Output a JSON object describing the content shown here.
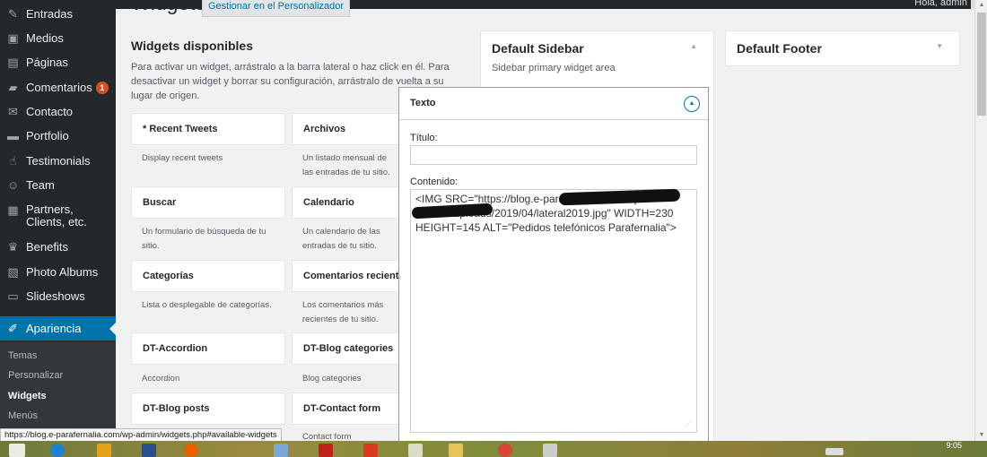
{
  "admin_bar": {
    "howdy": "Hola, admin"
  },
  "sidebar": {
    "items": [
      {
        "label": "Entradas",
        "icon": "pin-icon",
        "glyph": "✎"
      },
      {
        "label": "Medios",
        "icon": "media-icon",
        "glyph": "▣"
      },
      {
        "label": "Páginas",
        "icon": "pages-icon",
        "glyph": "▤"
      },
      {
        "label": "Comentarios",
        "icon": "comments-icon",
        "glyph": "▰",
        "badge": "1"
      },
      {
        "label": "Contacto",
        "icon": "mail-icon",
        "glyph": "✉"
      },
      {
        "label": "Portfolio",
        "icon": "briefcase-icon",
        "glyph": "▬"
      },
      {
        "label": "Testimonials",
        "icon": "thumbs-up-icon",
        "glyph": "☝"
      },
      {
        "label": "Team",
        "icon": "team-icon",
        "glyph": "☺"
      },
      {
        "label": "Partners, Clients, etc.",
        "icon": "grid-icon",
        "glyph": "▦"
      },
      {
        "label": "Benefits",
        "icon": "trophy-icon",
        "glyph": "♛"
      },
      {
        "label": "Photo Albums",
        "icon": "album-icon",
        "glyph": "▧"
      },
      {
        "label": "Slideshows",
        "icon": "slides-icon",
        "glyph": "▭"
      },
      {
        "label": "Apariencia",
        "icon": "paintbrush-icon",
        "glyph": "✐"
      }
    ],
    "submenu": [
      "Temas",
      "Personalizar",
      "Widgets",
      "Menús"
    ]
  },
  "page": {
    "title": "Widgets",
    "manage_link": "Gestionar en el Personalizador"
  },
  "available": {
    "heading": "Widgets disponibles",
    "description": "Para activar un widget, arrástralo a la barra lateral o haz click en él. Para desactivar un widget y borrar su configuración, arrástralo de vuelta a su lugar de origen.",
    "widgets": [
      {
        "name": "* Recent Tweets",
        "desc": "Display recent tweets"
      },
      {
        "name": "Archivos",
        "desc": "Un listado mensual de las entradas de tu sitio."
      },
      {
        "name": "Buscar",
        "desc": "Un formulario de búsqueda de tu sitio."
      },
      {
        "name": "Calendario",
        "desc": "Un calendario de las entradas de tu sitio."
      },
      {
        "name": "Categorías",
        "desc": "Lista o desplegable de categorías."
      },
      {
        "name": "Comentarios recientes",
        "desc": "Los comentarios más recientes de tu sitio."
      },
      {
        "name": "DT-Accordion",
        "desc": "Accordion"
      },
      {
        "name": "DT-Blog categories",
        "desc": "Blog categories"
      },
      {
        "name": "DT-Blog posts",
        "desc": ""
      },
      {
        "name": "DT-Contact form",
        "desc": "Contact form"
      }
    ]
  },
  "sidebars": {
    "default_sidebar": {
      "title": "Default Sidebar",
      "desc": "Sidebar primary widget area"
    },
    "default_footer": {
      "title": "Default Footer"
    }
  },
  "texto_widget": {
    "title": "Texto",
    "title_label": "Título:",
    "title_value": "",
    "content_label": "Contenido:",
    "content_value": "<IMG SRC=\"https://blog.e-parafernalia.com/wp-content/uploads/2019/04/lateral2019.jpg\" WIDTH=230 HEIGHT=145 ALT=\"Pedidos telefónicos Parafernalia\">"
  },
  "status_url": "https://blog.e-parafernalia.com/wp-admin/widgets.php#available-widgets",
  "taskbar": {
    "clock": "9:05"
  },
  "colors": {
    "admin_dark": "#23282d",
    "accent": "#0073aa",
    "badge": "#d54e21"
  }
}
